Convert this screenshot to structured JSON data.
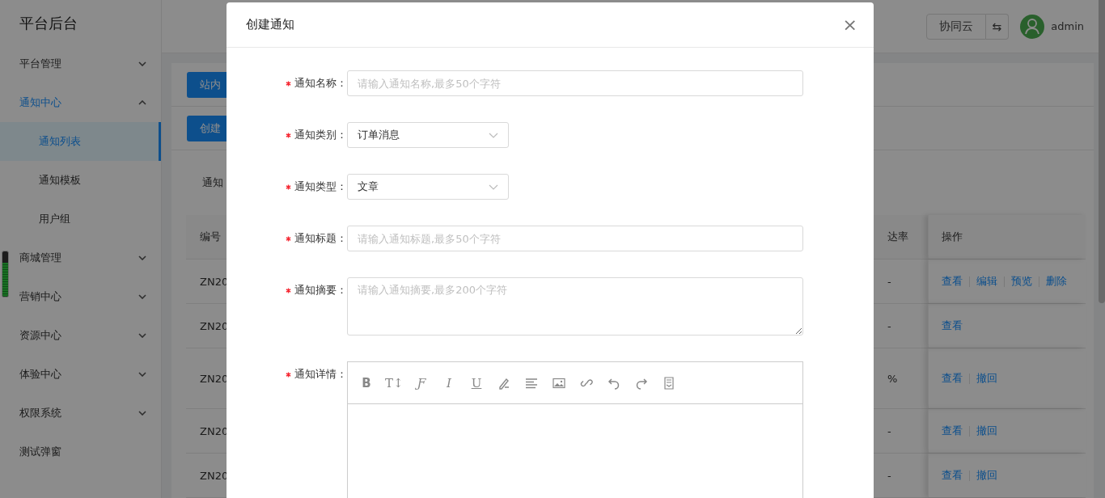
{
  "sidebar": {
    "title": "平台后台",
    "items": [
      {
        "kind": "group",
        "label": "平台管理",
        "expanded": false,
        "selected": false
      },
      {
        "kind": "group",
        "label": "通知中心",
        "expanded": true,
        "selected": true,
        "children": [
          {
            "label": "通知列表",
            "selected": true
          },
          {
            "label": "通知模板",
            "selected": false
          },
          {
            "label": "用户组",
            "selected": false
          }
        ]
      },
      {
        "kind": "group",
        "label": "商城管理",
        "expanded": false,
        "selected": false
      },
      {
        "kind": "group",
        "label": "营销中心",
        "expanded": false,
        "selected": false
      },
      {
        "kind": "group",
        "label": "资源中心",
        "expanded": false,
        "selected": false
      },
      {
        "kind": "group",
        "label": "体验中心",
        "expanded": false,
        "selected": false
      },
      {
        "kind": "group",
        "label": "权限系统",
        "expanded": false,
        "selected": false
      },
      {
        "kind": "link",
        "label": "测试弹窗",
        "selected": false
      }
    ]
  },
  "side_meter": {
    "level": 0.75
  },
  "header": {
    "workspace_button": "协同云",
    "switch_button": "⇆",
    "user": "admin"
  },
  "content": {
    "tab_button": "站内",
    "create_button": "创建",
    "filter_label": "通知",
    "table": {
      "columns": [
        "编号",
        "达率",
        "操作"
      ],
      "rows": [
        {
          "id": "ZN20",
          "rate": "-",
          "actions": [
            "查看",
            "编辑",
            "预览",
            "删除"
          ],
          "tall": false
        },
        {
          "id": "ZN20",
          "rate": "-",
          "actions": [
            "查看"
          ],
          "tall": false
        },
        {
          "id": "ZN20",
          "rate": "%",
          "actions": [
            "查看",
            "撤回"
          ],
          "tall": true
        },
        {
          "id": "ZN20",
          "rate": "-",
          "actions": [
            "查看",
            "撤回"
          ],
          "tall": false
        },
        {
          "id": "ZN20",
          "rate": "-",
          "actions": [
            "查看",
            "撤回"
          ],
          "tall": false
        }
      ]
    }
  },
  "dialog": {
    "title": "创建通知",
    "close": "×",
    "fields": [
      {
        "kind": "input",
        "label": "通知名称：",
        "required": true,
        "placeholder": "请输入通知名称,最多50个字符"
      },
      {
        "kind": "select",
        "label": "通知类别：",
        "required": true,
        "value": "订单消息"
      },
      {
        "kind": "select",
        "label": "通知类型：",
        "required": true,
        "value": "文章"
      },
      {
        "kind": "input",
        "label": "通知标题：",
        "required": true,
        "placeholder": "请输入通知标题,最多50个字符"
      },
      {
        "kind": "textarea",
        "label": "通知摘要：",
        "required": true,
        "placeholder": "请输入通知摘要,最多200个字符"
      },
      {
        "kind": "editor",
        "label": "通知详情：",
        "required": true,
        "toolbar": [
          {
            "kind": "bold",
            "text": "B"
          },
          {
            "kind": "size",
            "text": "T↕"
          },
          {
            "kind": "font",
            "text": "Ƒ"
          },
          {
            "kind": "italic",
            "text": "I"
          },
          {
            "kind": "underline",
            "text": "U"
          },
          {
            "kind": "pen"
          },
          {
            "kind": "align"
          },
          {
            "kind": "image"
          },
          {
            "kind": "link"
          },
          {
            "kind": "undo"
          },
          {
            "kind": "redo"
          },
          {
            "kind": "template"
          }
        ]
      }
    ]
  }
}
